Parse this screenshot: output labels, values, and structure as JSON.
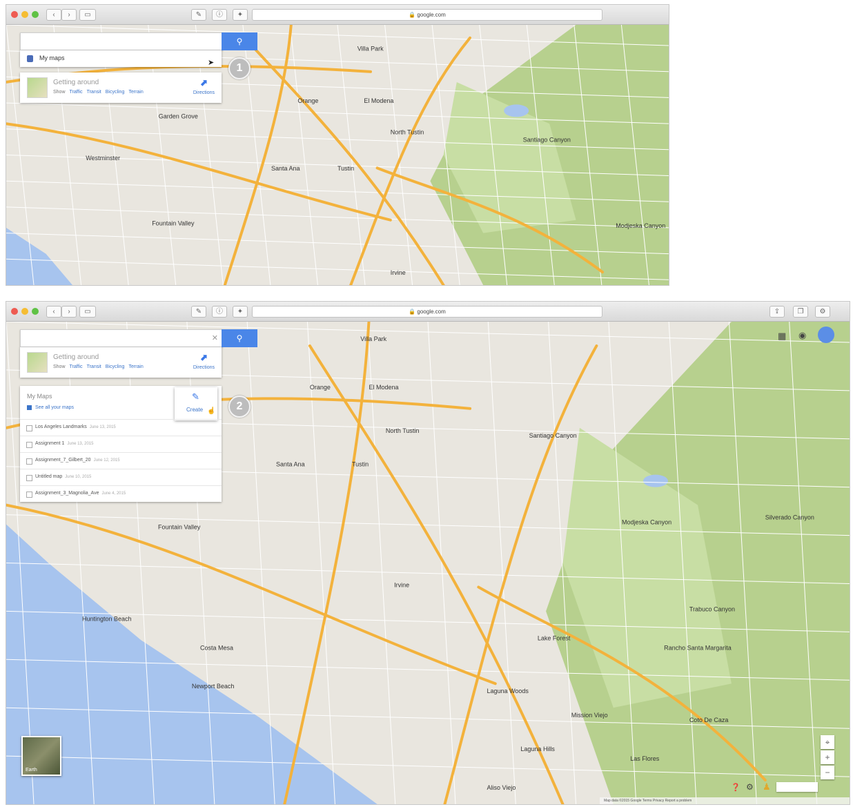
{
  "browser": {
    "url_top": "google.com",
    "url_bottom": "google.com"
  },
  "search": {
    "placeholder": "",
    "button_icon": "search-icon",
    "clear_icon": "close-icon"
  },
  "suggestion": {
    "my_maps_label": "My maps"
  },
  "getting_around": {
    "title": "Getting around",
    "show_label": "Show",
    "links": [
      "Traffic",
      "Transit",
      "Bicycling",
      "Terrain"
    ],
    "directions_label": "Directions"
  },
  "callouts": [
    "1",
    "2"
  ],
  "my_maps_panel": {
    "title": "My Maps",
    "see_all_label": "See all your maps",
    "create_label": "Create",
    "maps": [
      {
        "name": "Los Angeles Landmarks",
        "date": "June 13, 2015"
      },
      {
        "name": "Assignment 1",
        "date": "June 13, 2015"
      },
      {
        "name": "Assignment_7_Gilbert_20",
        "date": "June 12, 2015"
      },
      {
        "name": "Untitled map",
        "date": "June 10, 2015"
      },
      {
        "name": "Assignment_3_Magnolia_Ave",
        "date": "June 4, 2015"
      }
    ]
  },
  "map_labels": {
    "top": [
      {
        "text": "Orange"
      },
      {
        "text": "El Modena"
      },
      {
        "text": "Villa Park"
      },
      {
        "text": "Garden Grove"
      },
      {
        "text": "Westminster"
      },
      {
        "text": "Santa Ana"
      },
      {
        "text": "Tustin"
      },
      {
        "text": "North Tustin"
      },
      {
        "text": "Fountain Valley"
      },
      {
        "text": "Irvine"
      },
      {
        "text": "Santiago Canyon"
      },
      {
        "text": "Modjeska Canyon"
      }
    ],
    "bottom": [
      {
        "text": "Orange"
      },
      {
        "text": "El Modena"
      },
      {
        "text": "Villa Park"
      },
      {
        "text": "Santa Ana"
      },
      {
        "text": "Tustin"
      },
      {
        "text": "North Tustin"
      },
      {
        "text": "Fountain Valley"
      },
      {
        "text": "Irvine"
      },
      {
        "text": "Huntington Beach"
      },
      {
        "text": "Costa Mesa"
      },
      {
        "text": "Newport Beach"
      },
      {
        "text": "Lake Forest"
      },
      {
        "text": "Mission Viejo"
      },
      {
        "text": "Laguna Hills"
      },
      {
        "text": "Trabuco Canyon"
      },
      {
        "text": "Rancho Santa Margarita"
      },
      {
        "text": "Coto De Caza"
      },
      {
        "text": "Las Flores"
      },
      {
        "text": "Aliso Viejo"
      },
      {
        "text": "Laguna Woods"
      },
      {
        "text": "Santiago Canyon"
      },
      {
        "text": "Modjeska Canyon"
      },
      {
        "text": "Silverado Canyon"
      }
    ]
  },
  "earth_label": "Earth",
  "attribution": "Map data ©2015 Google   Terms   Privacy   Report a problem",
  "colors": {
    "land": "#e9e6df",
    "park": "#c8dea4",
    "hills": "#b7d08e",
    "water": "#a7c4ee",
    "highway": "#f3b23c",
    "road": "#ffffff",
    "accent": "#4a86e8"
  }
}
